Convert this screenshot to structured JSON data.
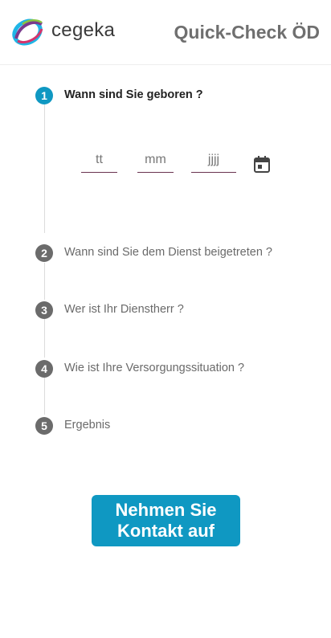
{
  "header": {
    "brand": "cegeka",
    "logo_icon": "cegeka-swirl-logo",
    "title": "Quick-Check ÖD"
  },
  "steps": [
    {
      "number": "1",
      "label": "Wann sind Sie geboren ?",
      "active": true
    },
    {
      "number": "2",
      "label": "Wann sind Sie dem Dienst beigetreten ?",
      "active": false
    },
    {
      "number": "3",
      "label": "Wer ist Ihr Dienstherr ?",
      "active": false
    },
    {
      "number": "4",
      "label": "Wie ist Ihre Versorgungssituation ?",
      "active": false
    },
    {
      "number": "5",
      "label": "Ergebnis",
      "active": false
    }
  ],
  "birthdate": {
    "day_placeholder": "tt",
    "month_placeholder": "mm",
    "year_placeholder": "jjjj",
    "calendar_icon": "calendar-icon"
  },
  "cta": {
    "label": "Nehmen Sie Kontakt auf"
  },
  "colors": {
    "accent": "#0f98c2",
    "step_inactive": "#6b6b6b",
    "field_underline": "#6a3350"
  }
}
